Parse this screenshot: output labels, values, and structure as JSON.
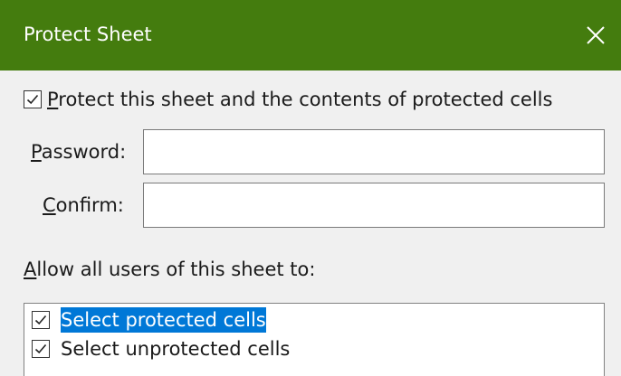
{
  "dialog": {
    "title": "Protect Sheet",
    "close_icon": "close-icon",
    "title_bar_color": "#447c0e"
  },
  "protect": {
    "checked": true,
    "label_first": "P",
    "label_rest": "rotect this sheet and the contents of protected cells"
  },
  "password": {
    "label_access": "P",
    "label_rest": "assword:",
    "value": ""
  },
  "confirm": {
    "label_access": "C",
    "label_rest": "onfirm:",
    "value": ""
  },
  "allow": {
    "label_access": "A",
    "label_rest": "llow all users of this sheet to:",
    "items": [
      {
        "label": "Select protected cells",
        "checked": true,
        "selected": true
      },
      {
        "label": "Select unprotected cells",
        "checked": true,
        "selected": false
      }
    ]
  },
  "colors": {
    "selection": "#0078d7"
  }
}
